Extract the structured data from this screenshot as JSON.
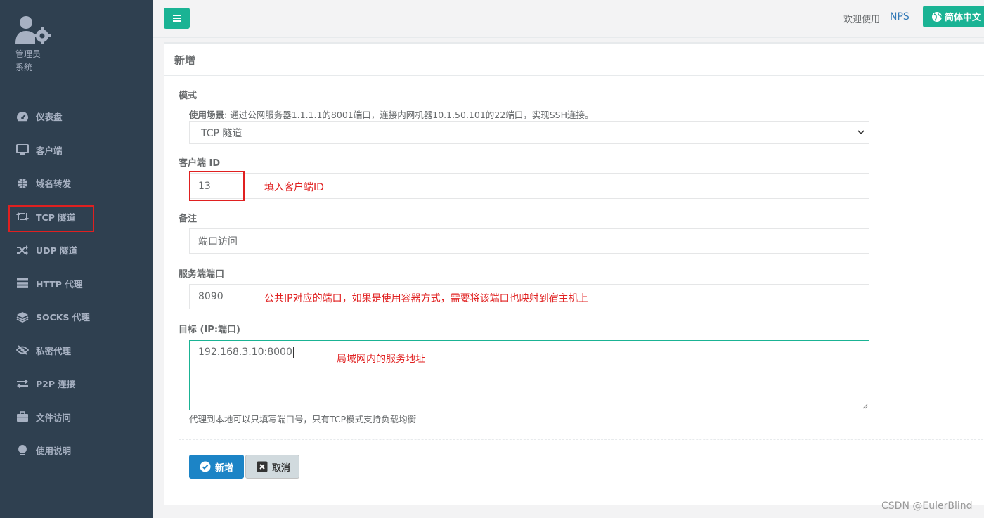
{
  "sidebar": {
    "profile": {
      "line1": "管理员",
      "line2": "系统"
    },
    "items": [
      {
        "label": "仪表盘",
        "icon": "dashboard-icon"
      },
      {
        "label": "客户端",
        "icon": "monitor-icon"
      },
      {
        "label": "域名转发",
        "icon": "globe-icon"
      },
      {
        "label": "TCP 隧道",
        "icon": "retweet-icon"
      },
      {
        "label": "UDP 隧道",
        "icon": "shuffle-icon"
      },
      {
        "label": "HTTP 代理",
        "icon": "server-icon"
      },
      {
        "label": "SOCKS 代理",
        "icon": "layers-icon"
      },
      {
        "label": "私密代理",
        "icon": "eye-slash-icon"
      },
      {
        "label": "P2P 连接",
        "icon": "exchange-icon"
      },
      {
        "label": "文件访问",
        "icon": "briefcase-icon"
      },
      {
        "label": "使用说明",
        "icon": "lightbulb-icon"
      }
    ]
  },
  "topbar": {
    "welcome": "欢迎使用",
    "brand": "NPS",
    "language": "简体中文"
  },
  "panel": {
    "title": "新增",
    "mode": {
      "label": "模式",
      "help_bold": "使用场景",
      "help_text": ": 通过公网服务器1.1.1.1的8001端口，连接内网机器10.1.50.101的22端口，实现SSH连接。",
      "selected": "TCP 隧道"
    },
    "client_id": {
      "label": "客户端 ID",
      "value": "13",
      "annotation": "填入客户端ID"
    },
    "remark": {
      "label": "备注",
      "value": "端口访问"
    },
    "server_port": {
      "label": "服务端端口",
      "value": "8090",
      "annotation": "公共IP对应的端口，如果是使用容器方式，需要将该端口也映射到宿主机上"
    },
    "target": {
      "label": "目标 (IP:端口)",
      "value": "192.168.3.10:8000",
      "annotation": "局域网内的服务地址",
      "help": "代理到本地可以只填写端口号，只有TCP模式支持负载均衡"
    },
    "buttons": {
      "submit": "新增",
      "cancel": "取消"
    }
  },
  "watermark": "CSDN @EulerBlind",
  "colors": {
    "sidebar": "#2f4050",
    "accent": "#1ab394",
    "primary": "#1c84c6",
    "annotation": "#e02020"
  }
}
